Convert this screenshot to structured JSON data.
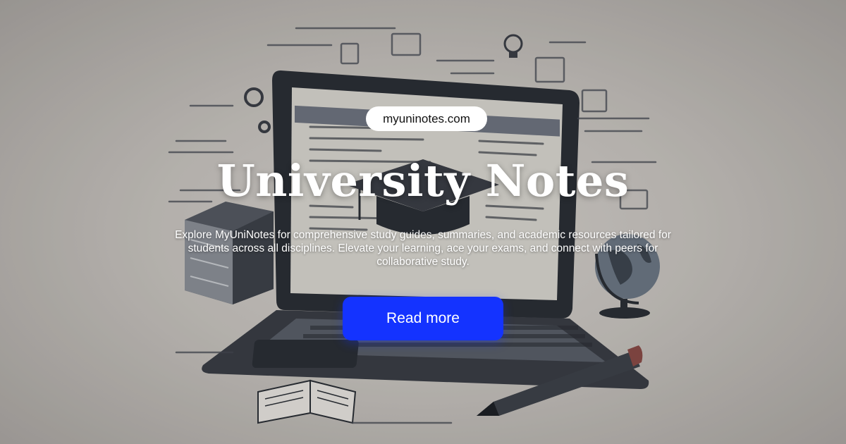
{
  "site": {
    "domain": "myuninotes.com"
  },
  "hero": {
    "title": "University Notes",
    "description": "Explore MyUniNotes for comprehensive study guides, summaries, and academic resources tailored for students across all disciplines. Elevate your learning, ace your exams, and connect with peers for collaborative study.",
    "cta_label": "Read more"
  },
  "colors": {
    "cta_background": "#1433ff",
    "badge_background": "#ffffff",
    "title_text": "#ffffff"
  },
  "illustration": {
    "icons": [
      "laptop-icon",
      "graduation-cap-icon",
      "books-icon",
      "globe-icon",
      "pencil-icon",
      "open-book-icon",
      "gear-icon",
      "lightbulb-icon"
    ]
  }
}
